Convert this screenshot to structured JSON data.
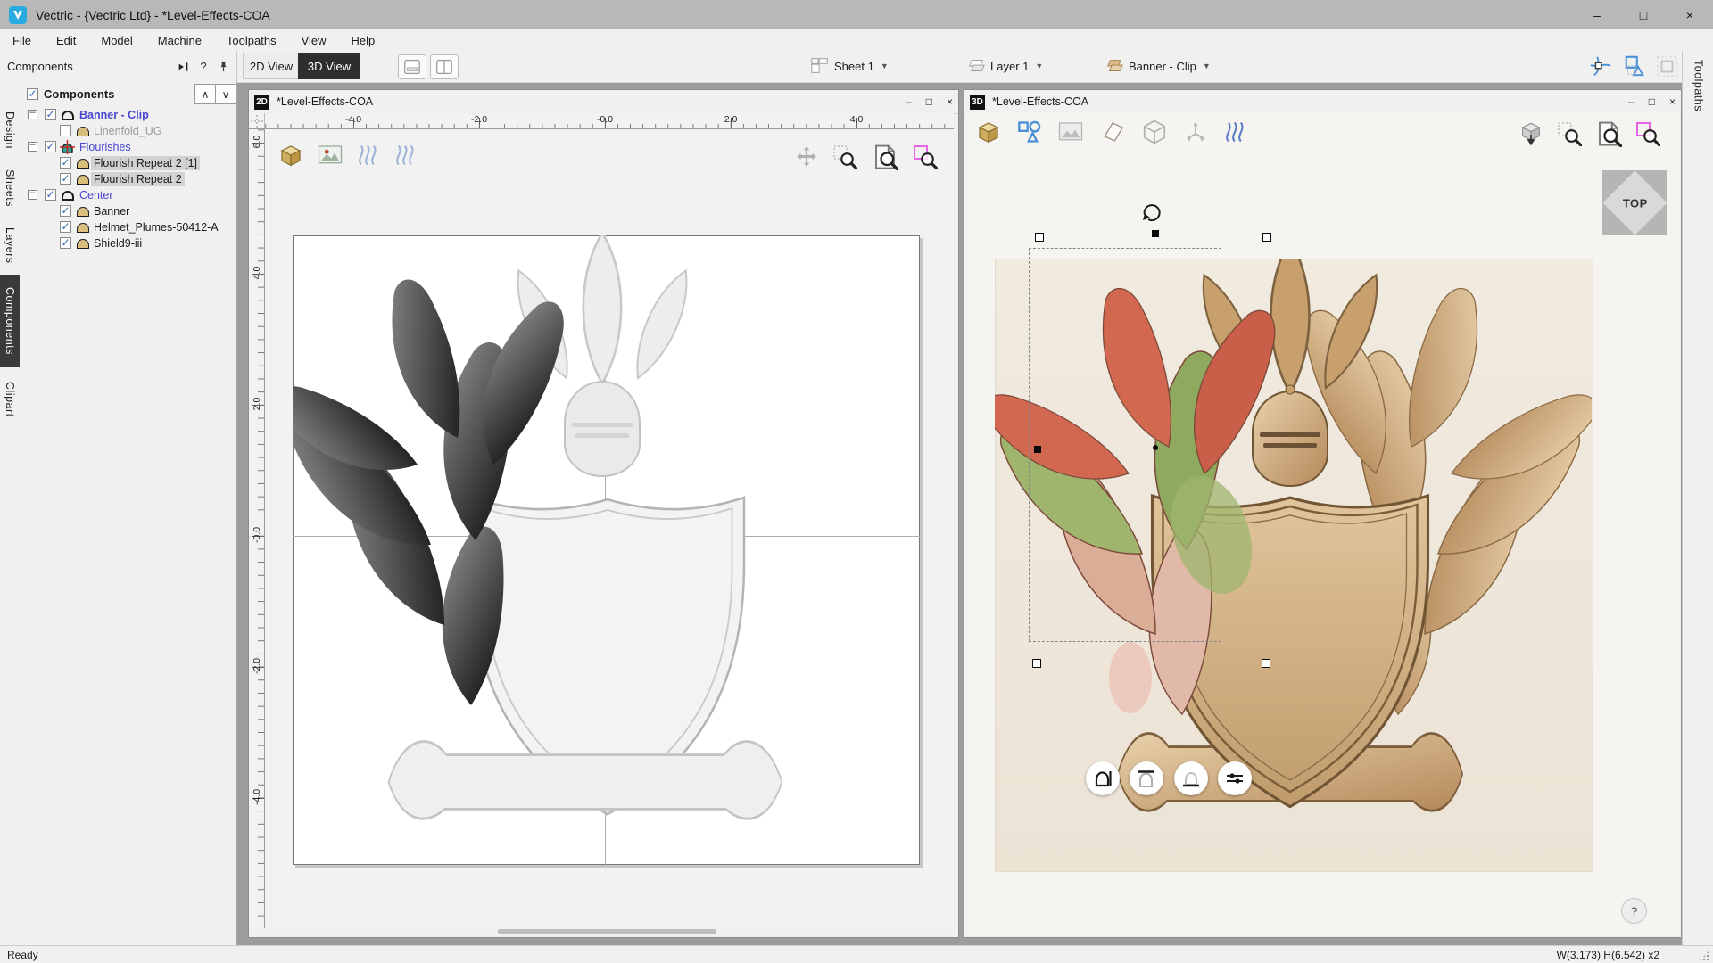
{
  "titlebar": {
    "title": "Vectric - {Vectric Ltd} - *Level-Effects-COA",
    "controls": {
      "minimize": "–",
      "maximize": "□",
      "close": "×"
    }
  },
  "menubar": {
    "items": [
      "File",
      "Edit",
      "Model",
      "Machine",
      "Toolpaths",
      "View",
      "Help"
    ]
  },
  "toolbar": {
    "view_tabs": [
      "2D View",
      "3D View"
    ],
    "active_view": "3D View",
    "sheet_dropdown": "Sheet 1",
    "layer_dropdown": "Layer 1",
    "level_dropdown": "Banner - Clip",
    "icons": [
      "single-pane-layout-icon",
      "split-pane-layout-icon",
      "snap-geometry-icon",
      "snap-shapes-icon",
      "snap-grid-icon"
    ]
  },
  "panel": {
    "header": "Components",
    "help_glyph": "?",
    "up_glyph": "∧",
    "down_glyph": "∨",
    "tree_root": "Components",
    "root_checked": true,
    "side_tabs": [
      {
        "label": "Design",
        "active": false
      },
      {
        "label": "Sheets",
        "active": false
      },
      {
        "label": "Layers",
        "active": false
      },
      {
        "label": "Components",
        "active": true
      },
      {
        "label": "Clipart",
        "active": false
      }
    ],
    "tree": [
      {
        "label": "Banner - Clip",
        "level": 1,
        "checked": true,
        "icon": "dome-outline",
        "color": "blue",
        "selected": false
      },
      {
        "label": "Linenfold_UG",
        "level": 2,
        "checked": false,
        "icon": "dome-tan",
        "color": "gray",
        "selected": false
      },
      {
        "label": "Flourishes",
        "level": 1,
        "checked": true,
        "icon": "dome-teal-target",
        "color": "blue",
        "selected": false
      },
      {
        "label": "Flourish Repeat 2 [1]",
        "level": 2,
        "checked": true,
        "icon": "dome-tan",
        "color": "black",
        "selected": true
      },
      {
        "label": "Flourish Repeat 2",
        "level": 2,
        "checked": true,
        "icon": "dome-tan",
        "color": "black",
        "selected": true
      },
      {
        "label": "Center",
        "level": 1,
        "checked": true,
        "icon": "dome-outline",
        "color": "blue",
        "selected": false
      },
      {
        "label": "Banner",
        "level": 2,
        "checked": true,
        "icon": "dome-tan",
        "color": "black",
        "selected": false
      },
      {
        "label": "Helmet_Plumes-50412-A",
        "level": 2,
        "checked": true,
        "icon": "dome-tan",
        "color": "black",
        "selected": false
      },
      {
        "label": "Shield9-iii",
        "level": 2,
        "checked": true,
        "icon": "dome-tan",
        "color": "black",
        "selected": false
      }
    ]
  },
  "right_strip": {
    "label": "Toolpaths"
  },
  "view2d": {
    "badge": "2D",
    "title": "*Level-Effects-COA",
    "ruler_top": [
      "-4.0",
      "-2.0",
      "-0.0",
      "2.0",
      "4.0"
    ],
    "ruler_left": [
      "6.0",
      "4.0",
      "2.0",
      "-0.0",
      "-2.0",
      "-4.0"
    ],
    "toolbar_icons": [
      "material-block-icon",
      "bitmap-image-icon",
      "toolpath-preview-icon",
      "toolpath-drawbar-icon"
    ],
    "nav_icons": [
      "pan-icon",
      "zoom-selection-icon",
      "zoom-fit-icon",
      "zoom-material-icon"
    ]
  },
  "view3d": {
    "badge": "3D",
    "title": "*Level-Effects-COA",
    "cube_label": "TOP",
    "help_glyph": "?",
    "toolbar_icons": [
      "material-block-icon",
      "vectors-visibility-icon",
      "bitmap-image-icon",
      "material-surface-icon",
      "wireframe-box-icon",
      "origin-axes-icon",
      "toolpath-preview-icon"
    ],
    "nav_icons": [
      "isometric-view-icon",
      "zoom-selection-icon",
      "zoom-fit-icon",
      "zoom-material-icon"
    ],
    "overlay_buttons": [
      "component-shape-height-icon",
      "component-fade-icon",
      "component-base-icon",
      "component-properties-sliders-icon"
    ]
  },
  "statusbar": {
    "left": "Ready",
    "right": "W(3.173) H(6.542) x2"
  },
  "colors": {
    "titlebar_bg": "#b8b8b8",
    "toolbar_bg": "#f0f0f0",
    "active_tab_bg": "#2e2e2e",
    "tree_blue": "#4848d0",
    "tree_disabled": "#9a9a9a",
    "tree_selected_bg": "#d2d2d2",
    "component_tan": "#d8bf7e",
    "component_teal": "#2fa093",
    "zoom_material_magenta": "#e466e4",
    "canvas_2d": "#f2f2f2",
    "canvas_3d": "#f6f4f1",
    "material_cream": "#f0e8dc",
    "flourish_red": "#d2684f",
    "flourish_green": "#9fb56d",
    "snap_blue": "#4a90d9"
  }
}
